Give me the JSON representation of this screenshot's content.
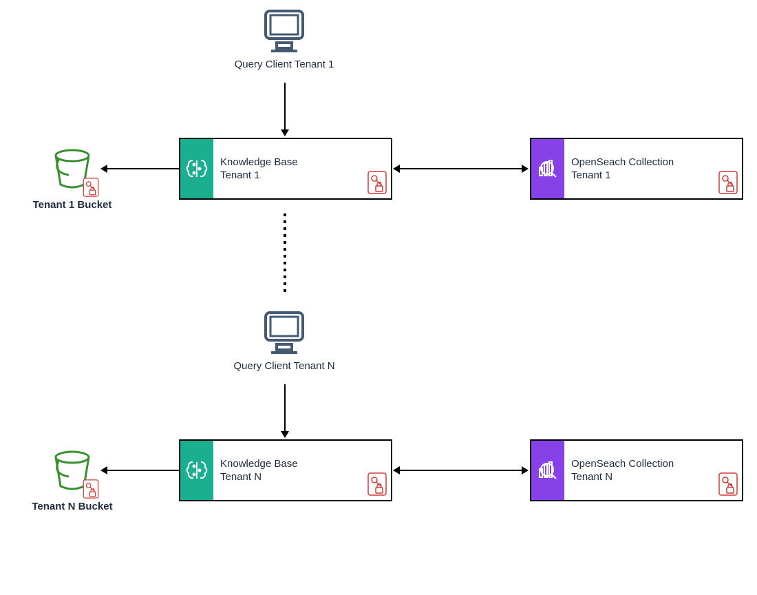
{
  "colors": {
    "teal": "#1aaf8f",
    "purple": "#8641e8",
    "green": "#3c8f31",
    "red": "#d13b3b",
    "slate": "#455a72"
  },
  "client1": {
    "label": "Query Client Tenant 1"
  },
  "clientN": {
    "label": "Query Client Tenant N"
  },
  "kb1": {
    "line1": "Knowledge Base",
    "line2": "Tenant 1"
  },
  "kbN": {
    "line1": "Knowledge Base",
    "line2": "Tenant N"
  },
  "os1": {
    "line1": "OpenSeach Collection",
    "line2": "Tenant 1"
  },
  "osN": {
    "line1": "OpenSeach Collection",
    "line2": "Tenant N"
  },
  "bucket1": {
    "label": "Tenant 1 Bucket"
  },
  "bucketN": {
    "label": "Tenant N Bucket"
  }
}
